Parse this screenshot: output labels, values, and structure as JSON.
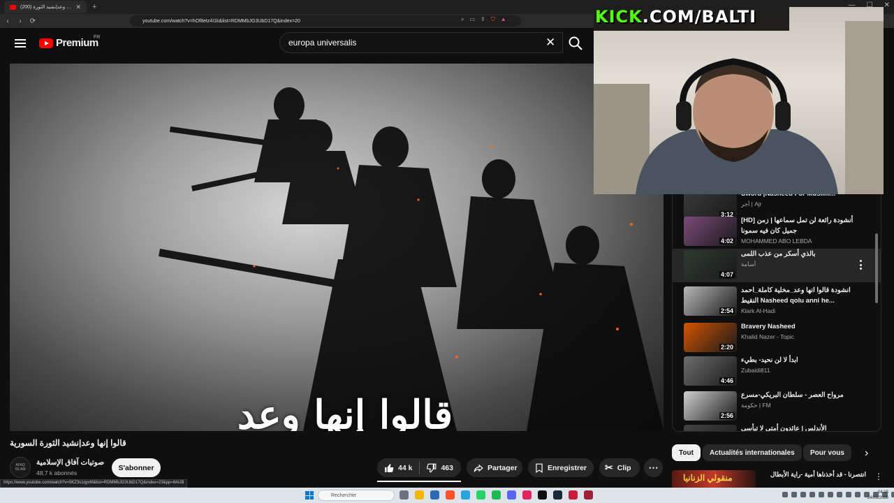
{
  "browser": {
    "tab_title": "(200) قالوا إنها وعد|نشيد الثورة",
    "url": "youtube.com/watch?v=hOf8etz4I1k&list=RDMMbJG3UbD17Q&index=20",
    "status_url": "https://www.youtube.com/watch?v=5KZ3s1qyvM&list=RDMMbJG3UbD17Q&index=23&pp=8AUB"
  },
  "header": {
    "logo_text": "Premium",
    "logo_region": "FR",
    "search_value": "europa universalis"
  },
  "video": {
    "overlay_text": "قالوا إنها وعد",
    "title": "قالوا إنها وعد|نشيد الثورة السورية"
  },
  "stream": {
    "banner_kick": "KICK",
    "banner_rest": ".COM/BALTI"
  },
  "channel": {
    "name": "صوتيات آفاق الإسلامية",
    "subs": "48,7 k abonnés",
    "avatar_text": "AFAQ ISLAM",
    "subscribe_label": "S'abonner"
  },
  "actions": {
    "likes": "44 k",
    "dislikes": "463",
    "share": "Partager",
    "save": "Enregistrer",
    "clip": "Clip"
  },
  "playlist": [
    {
      "title": "Sword |Nasheed For Muslim...",
      "channel": "أجر | Ajr",
      "duration": "3:12",
      "thumb": "#3a3a3a"
    },
    {
      "title": "[HD] أنشودة رائعة لن تمل سماعها | زمن جميل كان فيه سمونا",
      "channel": "MOHAMMED ABO LEBDA",
      "duration": "4:02",
      "thumb": "#7b4b7a"
    },
    {
      "title": "بالذي أسكر من عذب اللمى",
      "channel": "أسامة",
      "duration": "4:07",
      "thumb": "#2f3a33",
      "active": true
    },
    {
      "title": "انشودة قالوا انها وعد_مخلية كاملة_احمد النقيط Nasheed qolu anni he...",
      "channel": "Klark Al-Hadi",
      "duration": "2:54",
      "thumb": "#b8b8b8"
    },
    {
      "title": "Bravery Nasheed",
      "channel": "Khalid Nazer - Topic",
      "duration": "2:20",
      "thumb": "#d35400"
    },
    {
      "title": "ابدأ لا لن نحيد- بطيء",
      "channel": "Zubaidi811",
      "duration": "4:46",
      "thumb": "#6d6d6d"
    },
    {
      "title": "مرواح العصر - سلطان البريكي-مسرع",
      "channel": "حكومة | FM",
      "duration": "2:56",
      "thumb": "#cfcfcf"
    },
    {
      "title": "الأندلس | عائدون أمتي لا تيأسي",
      "channel": "",
      "duration": "",
      "thumb": "#444"
    }
  ],
  "chips": [
    "Tout",
    "Actualités internationales",
    "Pour vous"
  ],
  "recommendation": {
    "thumb_text": "منقولي الزنانيا",
    "title": "انتصرنا - قد أخذناها أمية -راية الأبطال"
  },
  "taskbar": {
    "search_placeholder": "Rechercher",
    "time": "04:15",
    "date": "24/03/2026"
  },
  "colors": {
    "accent": "#ff0000",
    "kick": "#53fc18",
    "background": "#0f0f0f"
  }
}
